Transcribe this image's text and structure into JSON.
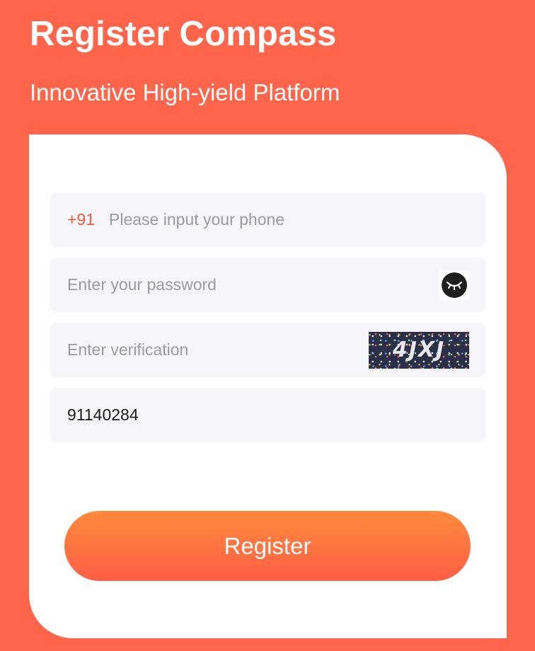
{
  "header": {
    "title": "Register Compass",
    "subtitle": "Innovative High-yield Platform"
  },
  "form": {
    "phone": {
      "prefix": "+91",
      "placeholder": "Please input your phone",
      "value": ""
    },
    "password": {
      "placeholder": "Enter your password",
      "value": "",
      "toggle_icon": "eye-closed-icon"
    },
    "verification": {
      "placeholder": "Enter verification",
      "value": "",
      "captcha_text": "4JXJ"
    },
    "invite_code": {
      "placeholder": "",
      "value": "91140284"
    }
  },
  "register_button": {
    "label": "Register"
  },
  "colors": {
    "background": "#FF654A",
    "accent": "#F05A3E",
    "field_bg": "#F6F5FA",
    "button_gradient_top": "#FF8A3C",
    "button_gradient_bottom": "#FF5F45"
  }
}
